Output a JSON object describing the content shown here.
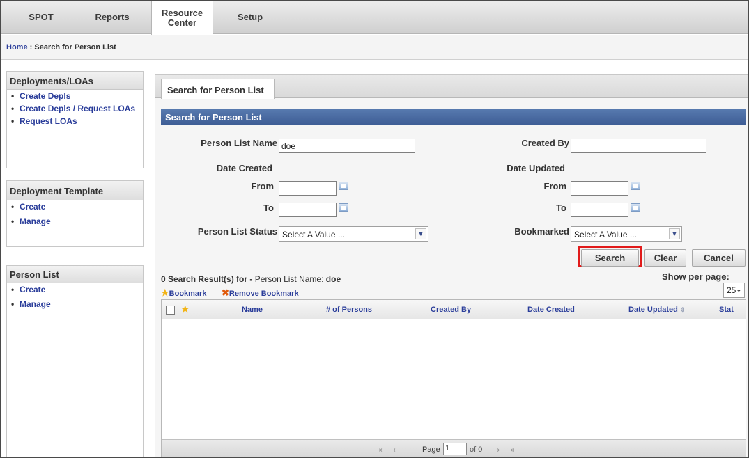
{
  "nav": {
    "tabs": [
      {
        "label": "SPOT"
      },
      {
        "label": "Reports"
      },
      {
        "label": "Resource Center"
      },
      {
        "label": "Setup"
      }
    ]
  },
  "breadcrumb": {
    "home": "Home",
    "separator": ":",
    "current": "Search for Person List"
  },
  "sidebar": {
    "deployments": {
      "title": "Deployments/LOAs",
      "items": [
        "Create Depls",
        "Create Depls / Request LOAs",
        "Request LOAs"
      ]
    },
    "template": {
      "title": "Deployment Template",
      "items": [
        "Create",
        "Manage"
      ]
    },
    "person_list": {
      "title": "Person List",
      "items": [
        "Create",
        "Manage"
      ]
    }
  },
  "main": {
    "tab_label": "Search for Person List",
    "section_title": "Search for Person List",
    "form": {
      "person_list_name_label": "Person List Name",
      "person_list_name_value": "doe",
      "created_by_label": "Created By",
      "created_by_value": "",
      "date_created_label": "Date Created",
      "date_updated_label": "Date Updated",
      "from_label": "From",
      "to_label": "To",
      "person_list_status_label": "Person List Status",
      "person_list_status_value": "Select A Value ...",
      "bookmarked_label": "Bookmarked",
      "bookmarked_value": "Select A Value ..."
    },
    "buttons": {
      "search": "Search",
      "clear": "Clear",
      "cancel": "Cancel"
    },
    "results": {
      "count_text": "0 Search Result(s) for -",
      "criteria_label": "Person List Name:",
      "criteria_value": "doe",
      "show_per_page_label": "Show per page:",
      "per_page_value": "25",
      "bookmark_label": "Bookmark",
      "remove_bookmark_label": "Remove Bookmark",
      "columns": [
        "Name",
        "# of Persons",
        "Created By",
        "Date Created",
        "Date Updated",
        "Stat"
      ]
    },
    "pager": {
      "page_label": "Page",
      "page_value": "1",
      "of_label": "of 0"
    }
  },
  "colors": {
    "accent_header": "#4a6aa3",
    "link": "#2a3d9a",
    "highlight": "#e11b1b"
  }
}
